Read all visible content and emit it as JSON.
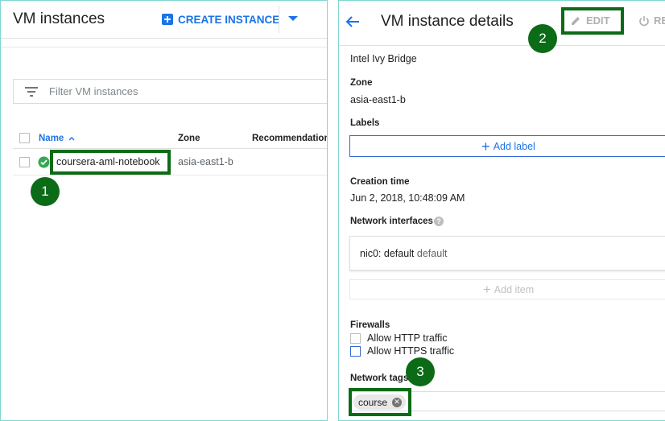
{
  "list": {
    "title": "VM instances",
    "create_label": "CREATE INSTANCE",
    "filter_placeholder": "Filter VM instances",
    "columns": {
      "name": "Name",
      "zone": "Zone",
      "recommendation": "Recommendation"
    },
    "rows": [
      {
        "name": "coursera-aml-notebook",
        "zone": "asia-east1-b",
        "status": "running"
      }
    ]
  },
  "details": {
    "title": "VM instance details",
    "edit_label": "EDIT",
    "reset_label": "RE",
    "cpu_platform": "Intel Ivy Bridge",
    "zone_label": "Zone",
    "zone_value": "asia-east1-b",
    "labels_label": "Labels",
    "add_label": "Add label",
    "creation_label": "Creation time",
    "creation_value": "Jun 2, 2018, 10:48:09 AM",
    "network_interfaces_label": "Network interfaces",
    "nic_name": "nic0: default",
    "nic_network": "default",
    "add_item": "Add item",
    "firewalls_label": "Firewalls",
    "firewall_http": "Allow HTTP traffic",
    "firewall_https": "Allow HTTPS traffic",
    "network_tags_label": "Network tags",
    "tags": [
      "course"
    ]
  },
  "annotations": {
    "one": "1",
    "two": "2",
    "three": "3"
  },
  "colors": {
    "accent": "#1a73e8",
    "highlight": "#0c6b16",
    "running": "#34a853"
  }
}
